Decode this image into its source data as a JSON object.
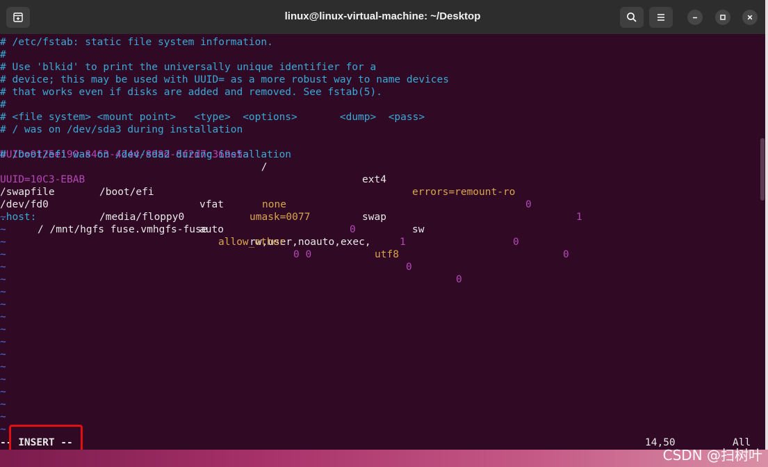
{
  "window": {
    "title": "linux@linux-virtual-machine: ~/Desktop",
    "icons": {
      "new_tab": "new-tab-icon",
      "search": "search-icon",
      "menu": "hamburger-menu-icon",
      "minimize": "minimize-icon",
      "maximize": "maximize-icon",
      "close": "close-icon"
    }
  },
  "file": {
    "l1": "# /etc/fstab: static file system information.",
    "l2": "#",
    "l3": "# Use 'blkid' to print the universally unique identifier for a",
    "l4": "# device; this may be used with UUID= as a more robust way to name devices",
    "l5": "# that works even if disks are added and removed. See fstab(5).",
    "l6": "#",
    "l7": "# <file system> <mount point>   <type>  <options>       <dump>  <pass>",
    "l8": "# / was on /dev/sda3 during installation",
    "l9": {
      "uuid": "UUID=9125e190-8463-4244-898d-8f2d7c369e5a",
      "mount": " /",
      "type": "ext4",
      "opts": "errors=remount-ro",
      "dump": "0",
      "pass": "1"
    },
    "l10": "# /boot/efi was on /dev/sda2 during installation",
    "l11": {
      "uuid": "UUID=10C3-EBAB",
      "mount": "/boot/efi",
      "type": "vfat",
      "opts": "umask=0077",
      "dump": "0",
      "pass": "1"
    },
    "l12": {
      "fs": "/swapfile",
      "mount": "none",
      "type": "swap",
      "opts": "sw",
      "dump": "0",
      "pass": "0"
    },
    "l13": {
      "fs": "/dev/fd0",
      "mount": "/media/floppy0",
      "type": "auto",
      "opts": "rw,user,noauto,exec,",
      "opts2": "utf8",
      "dump": "0",
      "pass": "0"
    },
    "l14": {
      "host": ".host:",
      "rest": "/ /mnt/hgfs fuse.vmhgfs-fuse",
      "opts": "allow_other",
      "nums": "0 0"
    },
    "tilde": "~"
  },
  "status": {
    "mode": "-- INSERT --",
    "position": "14,50",
    "scroll": "All"
  },
  "watermark": "CSDN @扫树叶",
  "colors": {
    "background": "#300a24",
    "comment": "#39a9d8",
    "identifier": "#b447b8",
    "option": "#d9a54e",
    "tilde": "#4a6fd6",
    "highlight_box": "#e01010"
  }
}
